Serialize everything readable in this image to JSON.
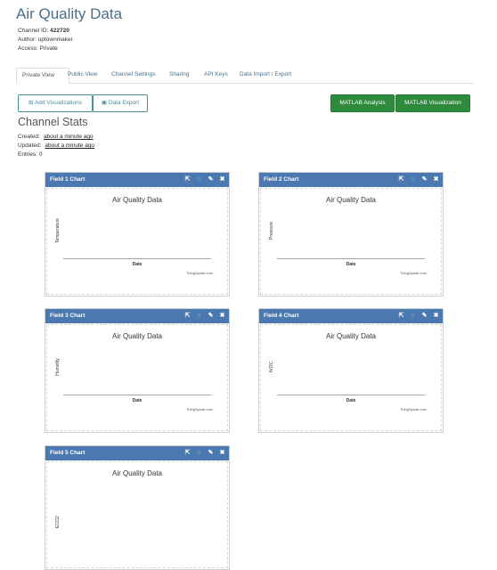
{
  "page": {
    "title": "Air Quality Data",
    "channel_id_label": "Channel ID:",
    "channel_id": "422720",
    "author": "Author: uptownmaker",
    "access": "Access: Private"
  },
  "tabs": [
    {
      "label": "Private View"
    },
    {
      "label": "Public View"
    },
    {
      "label": "Channel Settings"
    },
    {
      "label": "Sharing"
    },
    {
      "label": "API Keys"
    },
    {
      "label": "Data Import / Export"
    }
  ],
  "toolbar": {
    "add_visualizations": "Add Visualizations",
    "data_export": "Data Export",
    "matlab_analysis": "MATLAB Analysis",
    "matlab_visualization": "MATLAB Visualization",
    "accent_color": "#2e8b3d"
  },
  "stats": {
    "heading": "Channel Stats",
    "created_label": "Created:",
    "created_value": "about a minute ago",
    "updated_label": "Updated:",
    "updated_value": "about a minute ago",
    "entries": "Entries: 0"
  },
  "charts": [
    {
      "header": "Field 1 Chart",
      "title": "Air Quality Data",
      "ylabel": "Temperature",
      "xlabel": "Date",
      "credit": "ThingSpeak.com"
    },
    {
      "header": "Field 2 Chart",
      "title": "Air Quality Data",
      "ylabel": "Pressure",
      "xlabel": "Date",
      "credit": "ThingSpeak.com"
    },
    {
      "header": "Field 3 Chart",
      "title": "Air Quality Data",
      "ylabel": "Humidity",
      "xlabel": "Date",
      "credit": "ThingSpeak.com"
    },
    {
      "header": "Field 4 Chart",
      "title": "Air Quality Data",
      "ylabel": "tVOC",
      "xlabel": "Date",
      "credit": "ThingSpeak.com"
    },
    {
      "header": "Field 5 Chart",
      "title": "Air Quality Data",
      "ylabel": "ECO2",
      "xlabel": "",
      "credit": ""
    }
  ],
  "panel_icons": [
    "external-link-icon",
    "comment-icon",
    "pencil-icon",
    "close-icon"
  ],
  "colors": {
    "panel_header": "#4a78b0",
    "title": "#4a6f8a"
  }
}
